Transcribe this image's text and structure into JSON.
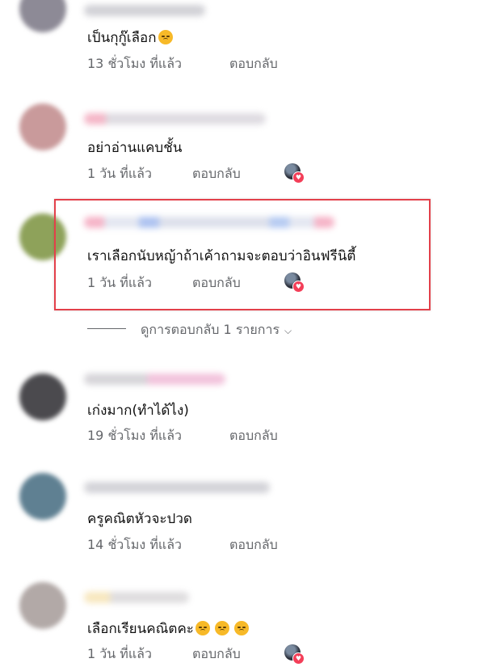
{
  "comments": [
    {
      "text": "เป็นกุกู๊เลือก",
      "time": "13 ชั่วโมง ที่แล้ว",
      "reply": "ตอบกลับ",
      "has_reaction": false,
      "emoji": "sad-face"
    },
    {
      "text": "อย่าอ่านแคบชั้น",
      "time": "1 วัน ที่แล้ว",
      "reply": "ตอบกลับ",
      "has_reaction": true
    },
    {
      "text": "เราเลือกนับหญ้าถ้าเค้าถามจะตอบว่าอินฟรีนิตี้",
      "time": "1 วัน ที่แล้ว",
      "reply": "ตอบกลับ",
      "has_reaction": true,
      "highlighted": true
    },
    {
      "text": "เก่งมาก(ทำได้ไง)",
      "time": "19 ชั่วโมง ที่แล้ว",
      "reply": "ตอบกลับ",
      "has_reaction": false
    },
    {
      "text": "ครูคณิตหัวจะปวด",
      "time": "14 ชั่วโมง ที่แล้ว",
      "reply": "ตอบกลับ",
      "has_reaction": false
    },
    {
      "text": "เลือกเรียนคณิตคะ",
      "time": "1 วัน ที่แล้ว",
      "reply": "ตอบกลับ",
      "has_reaction": true,
      "emoji": "sad-face x3"
    }
  ],
  "view_replies": {
    "label": "ดูการตอบกลับ 1 รายการ"
  },
  "colors": {
    "highlight_border": "#e3404a",
    "meta_text": "#65676b",
    "reaction_heart": "#f33e58"
  }
}
